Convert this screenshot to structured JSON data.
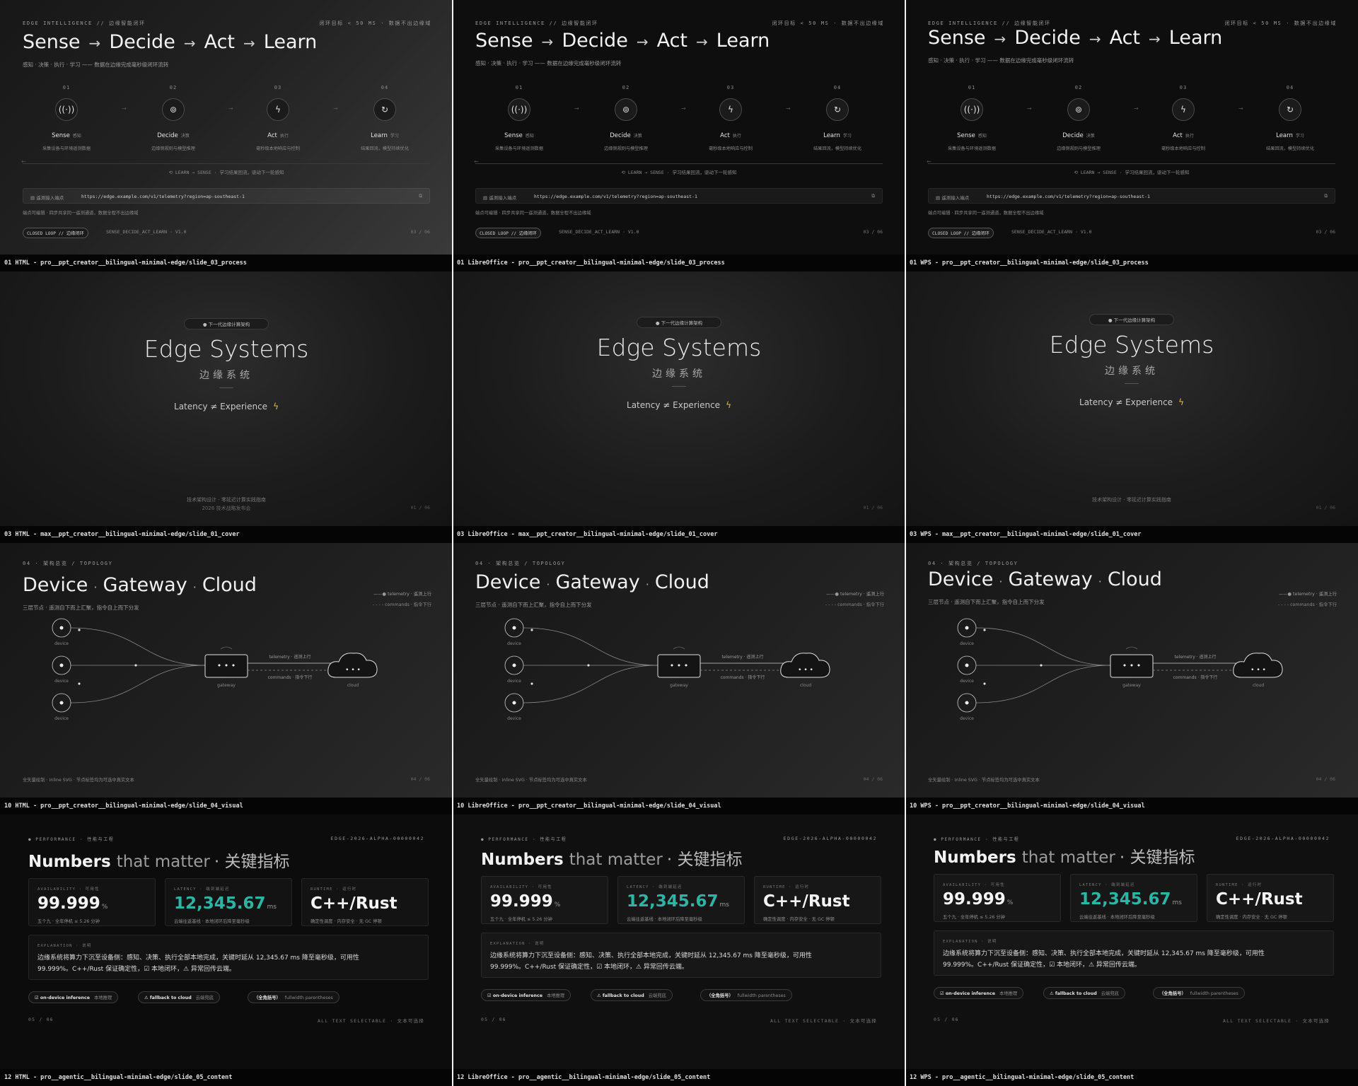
{
  "rows": [
    {
      "kind": "process",
      "captions": [
        "01 HTML - pro__ppt_creator__bilingual-minimal-edge/slide_03_process",
        "01 LibreOffice - pro__ppt_creator__bilingual-minimal-edge/slide_03_process",
        "01 WPS - pro__ppt_creator__bilingual-minimal-edge/slide_03_process"
      ],
      "kicker": "EDGE INTELLIGENCE // 边缘智能闭环",
      "target": "闭环目标 < 50 MS · 数据不出边缘域",
      "title": [
        "Sense",
        "Decide",
        "Act",
        "Learn"
      ],
      "arrow": "→",
      "subtitle": "感知 · 决策 · 执行 · 学习 —— 数据在边缘完成毫秒级闭环流转",
      "steps": [
        {
          "num": "01",
          "en": "Sense",
          "cn": "感知",
          "desc": "采集设备与环境遥测数据",
          "icon": "((·))"
        },
        {
          "num": "02",
          "en": "Decide",
          "cn": "决策",
          "desc": "边缘侧规则与模型推理",
          "icon": "⊚"
        },
        {
          "num": "03",
          "en": "Act",
          "cn": "执行",
          "desc": "毫秒级本地响应与控制",
          "icon": "ϟ"
        },
        {
          "num": "04",
          "en": "Learn",
          "cn": "学习",
          "desc": "结果回流，模型持续优化",
          "icon": "↻"
        }
      ],
      "loop_note": "⟲ LEARN → SENSE · 学习结果回流，驱动下一轮感知",
      "url_label": "遥测接入端点",
      "url": "https://edge.example.com/v1/telemetry?region=ap-southeast-1",
      "url_note": "端点可编辑 · 四步共享同一遥测通道，数据全程不出边缘域",
      "badge": "CLOSED LOOP // 边缘闭环",
      "code": "SENSE_DECIDE_ACT_LEARN · V1.0",
      "page": "03 / 06"
    },
    {
      "kind": "cover",
      "captions": [
        "03 HTML - max__ppt_creator__bilingual-minimal-edge/slide_01_cover",
        "03 LibreOffice - max__ppt_creator__bilingual-minimal-edge/slide_01_cover",
        "03 WPS - max__ppt_creator__bilingual-minimal-edge/slide_01_cover"
      ],
      "pill": "下一代边缘计算架构",
      "title": "Edge Systems",
      "title_cn": "边缘系统",
      "tagline": "Latency ≠ Experience",
      "bolt": "ϟ",
      "footer1": "技术架构设计 · 零延迟计算实践指南",
      "footer2": "2026 技术战略发布会",
      "page": "01 / 06"
    },
    {
      "kind": "topology",
      "captions": [
        "10 HTML - pro__ppt_creator__bilingual-minimal-edge/slide_04_visual",
        "10 LibreOffice - pro__ppt_creator__bilingual-minimal-edge/slide_04_visual",
        "10 WPS - pro__ppt_creator__bilingual-minimal-edge/slide_04_visual"
      ],
      "kicker": "04 · 架构总览 / TOPOLOGY",
      "title_parts": [
        "Device",
        "Gateway",
        "Cloud"
      ],
      "sep": "·",
      "subtitle": "三层节点 · 遥测自下而上汇聚，指令自上而下分发",
      "legend_telemetry": "telemetry · 遥测上行",
      "legend_commands": "commands · 指令下行",
      "node_device": "device",
      "node_gateway": "gateway",
      "node_cloud": "cloud",
      "edge_telemetry": "telemetry · 遥测上行",
      "edge_commands": "commands · 指令下行",
      "footer": "全矢量绘制 · Inline SVG · 节点标签均为可选中真实文本",
      "page": "04 / 06"
    },
    {
      "kind": "numbers",
      "captions": [
        "12 HTML - pro__agentic__bilingual-minimal-edge/slide_05_content",
        "12 LibreOffice - pro__agentic__bilingual-minimal-edge/slide_05_content",
        "12 WPS - pro__agentic__bilingual-minimal-edge/slide_05_content"
      ],
      "kicker": "PERFORMANCE · 性能与工程",
      "code": "EDGE-2026-ALPHA-00000042",
      "title_bold": "Numbers",
      "title_light": "that matter",
      "title_cn": "· 关键指标",
      "cards": [
        {
          "k": "AVAILABILITY · 可用性",
          "v": "99.999",
          "u": "%",
          "d": "五个九 · 全年停机 ≤ 5.26 分钟",
          "teal": false
        },
        {
          "k": "LATENCY · 端到端延迟",
          "v": "12,345.67",
          "u": "ms",
          "d": "云端往返基线 · 本地闭环后降至毫秒级",
          "teal": true
        },
        {
          "k": "RUNTIME · 运行时",
          "v": "C++/Rust",
          "u": "",
          "d": "确定性调度 · 内存安全 · 无 GC 停顿",
          "teal": false
        }
      ],
      "expl_k": "EXPLANATION · 说明",
      "expl_1": "边缘系统将算力下沉至设备侧：感知、决策、执行全部本地完成，关键时延从 12,345.67 ms 降至毫秒级，可用性",
      "expl_2": "99.999%。C++/Rust 保证确定性，☑ 本地闭环，⚠ 异常回传云端。",
      "pills": [
        {
          "icon": "☑",
          "a": "on-device inference",
          "b": "本地推理"
        },
        {
          "icon": "⚠",
          "a": "fallback to cloud",
          "b": "云端兜底"
        },
        {
          "icon": "",
          "a": "（全角括号）",
          "b": "fullwidth parentheses"
        }
      ],
      "page": "05 / 06",
      "footer": "ALL TEXT SELECTABLE · 文本可选择"
    }
  ]
}
